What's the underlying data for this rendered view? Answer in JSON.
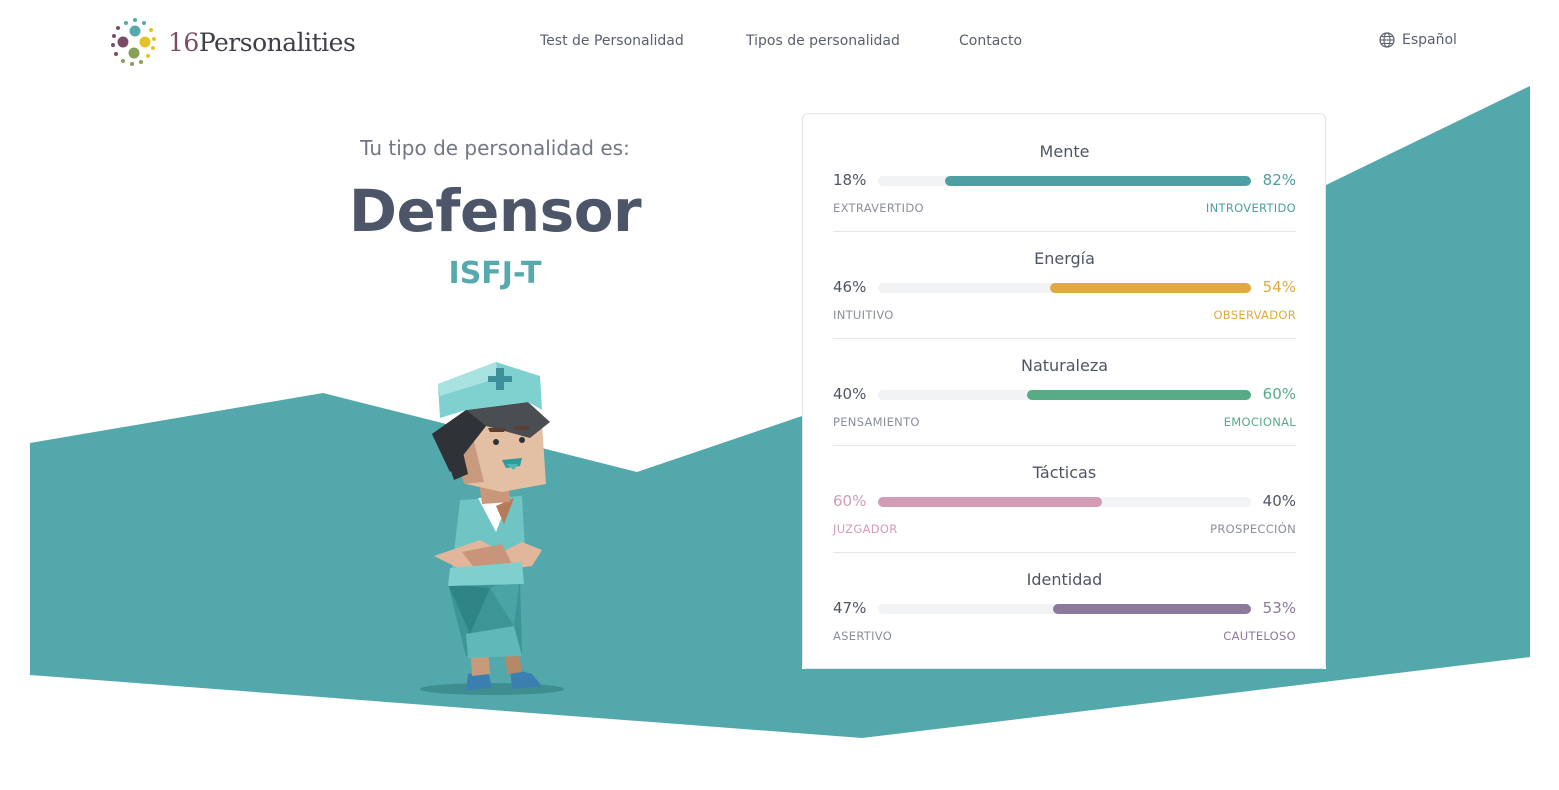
{
  "header": {
    "logo_num": "16",
    "logo_word": "Personalities",
    "nav": [
      "Test de Personalidad",
      "Tipos de personalidad",
      "Contacto"
    ],
    "language": "Español"
  },
  "hero": {
    "subtitle": "Tu tipo de personalidad es:",
    "type_name": "Defensor",
    "type_code": "ISFJ-T"
  },
  "colors": {
    "teal_bg": "#52a8aa",
    "mind": "#4d9fa4",
    "energy": "#e2a942",
    "nature": "#56ab85",
    "tactics": "#d29bb6",
    "identity": "#8c799c"
  },
  "traits": [
    {
      "name": "Mente",
      "left_pct": "18%",
      "right_pct": "82%",
      "left_label": "EXTRAVERTIDO",
      "right_label": "INTROVERTIDO",
      "dominant": "right",
      "value": 82,
      "color": "#4d9fa4"
    },
    {
      "name": "Energía",
      "left_pct": "46%",
      "right_pct": "54%",
      "left_label": "INTUITIVO",
      "right_label": "OBSERVADOR",
      "dominant": "right",
      "value": 54,
      "color": "#e2a942"
    },
    {
      "name": "Naturaleza",
      "left_pct": "40%",
      "right_pct": "60%",
      "left_label": "PENSAMIENTO",
      "right_label": "EMOCIONAL",
      "dominant": "right",
      "value": 60,
      "color": "#56ab85"
    },
    {
      "name": "Tácticas",
      "left_pct": "60%",
      "right_pct": "40%",
      "left_label": "JUZGADOR",
      "right_label": "PROSPECCIÓN",
      "dominant": "left",
      "value": 60,
      "color": "#d29bb6"
    },
    {
      "name": "Identidad",
      "left_pct": "47%",
      "right_pct": "53%",
      "left_label": "ASERTIVO",
      "right_label": "CAUTELOSO",
      "dominant": "right",
      "value": 53,
      "color": "#8c799c"
    }
  ]
}
